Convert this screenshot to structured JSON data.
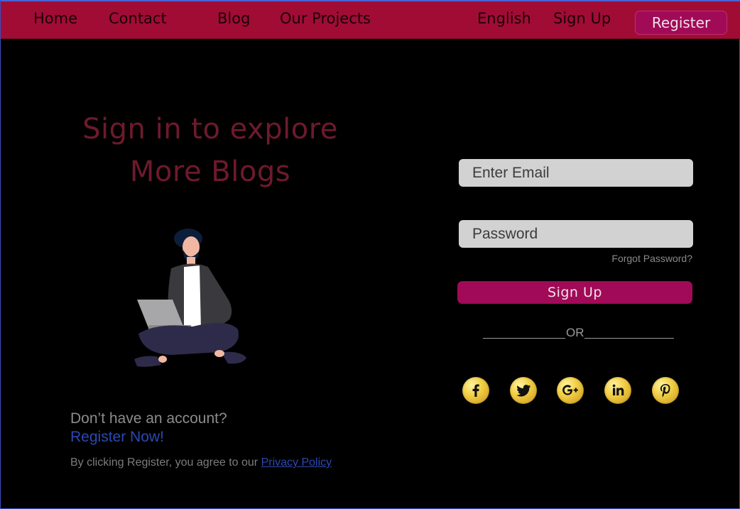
{
  "nav": {
    "home": "Home",
    "contact": "Contact",
    "blog": "Blog",
    "projects": "Our Projects",
    "language": "English",
    "signup": "Sign Up",
    "register": "Register"
  },
  "hero": {
    "headline_line1": "Sign in to explore",
    "headline_line2": "More Blogs"
  },
  "form": {
    "email_placeholder": "Enter Email",
    "password_placeholder": "Password",
    "forgot": "Forgot Password?",
    "submit": "Sign Up",
    "or": "OR"
  },
  "footer": {
    "no_account": "Don’t have an account?",
    "register_now": "Register Now!",
    "agree_prefix": "By clicking Register, you agree to our ",
    "privacy": "Privacy Policy"
  },
  "social": [
    "facebook-icon",
    "twitter-icon",
    "google-plus-icon",
    "linkedin-icon",
    "pinterest-icon"
  ],
  "colors": {
    "nav_bg": "#a10c35",
    "accent": "#a00a57",
    "headline": "#6e1a2c",
    "link": "#2b49b3",
    "social_gold": "#f2cf45"
  }
}
